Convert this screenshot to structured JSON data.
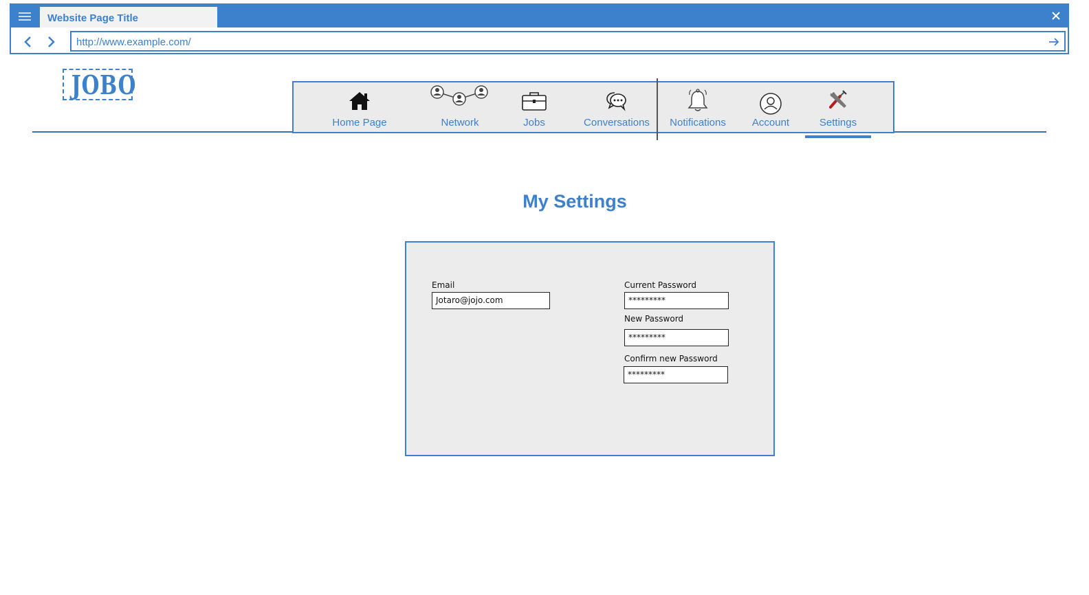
{
  "browser": {
    "tab_title": "Website Page Title",
    "url": "http://www.example.com/"
  },
  "logo": {
    "text": "JOBO"
  },
  "nav": {
    "items": [
      {
        "label": "Home Page",
        "icon": "home-icon"
      },
      {
        "label": "Network",
        "icon": "network-icon"
      },
      {
        "label": "Jobs",
        "icon": "briefcase-icon"
      },
      {
        "label": "Conversations",
        "icon": "chat-icon"
      },
      {
        "label": "Notifications",
        "icon": "bell-icon"
      },
      {
        "label": "Account",
        "icon": "user-icon"
      },
      {
        "label": "Settings",
        "icon": "tools-icon",
        "active": true
      }
    ]
  },
  "page": {
    "title": "My Settings"
  },
  "settings": {
    "email_label": "Email",
    "email_value": "Jotaro@jojo.com",
    "current_password_label": "Current Password",
    "current_password_value": "*********",
    "new_password_label": "New Password",
    "new_password_value": "*********",
    "confirm_password_label": "Confirm new Password",
    "confirm_password_value": "*********"
  },
  "colors": {
    "accent": "#3d80cc",
    "panel_bg": "#ececec",
    "settings_icon_red": "#b0201c"
  }
}
